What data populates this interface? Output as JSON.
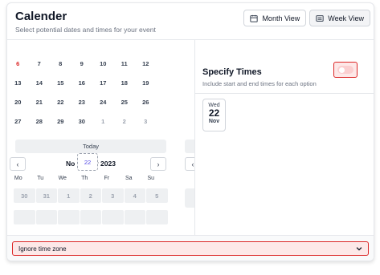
{
  "header": {
    "title": "Calender",
    "subtitle": "Select potential dates and times for your event",
    "month_view_label": "Month View",
    "week_view_label": "Week View"
  },
  "calendar": {
    "weeks": [
      [
        "6",
        "7",
        "8",
        "9",
        "10",
        "11",
        "12"
      ],
      [
        "13",
        "14",
        "15",
        "16",
        "17",
        "18",
        "19"
      ],
      [
        "20",
        "21",
        "22",
        "23",
        "24",
        "25",
        "26"
      ],
      [
        "27",
        "28",
        "29",
        "30",
        "1",
        "2",
        "3"
      ]
    ],
    "today_label": "Today",
    "month_label_left": "No",
    "month_label_right": "r 2023",
    "prev_icon": "‹",
    "next_icon": "›",
    "floating_date": "22",
    "weekdays": [
      "Mo",
      "Tu",
      "We",
      "Th",
      "Fr",
      "Sa",
      "Su"
    ],
    "next_week": [
      "30",
      "31",
      "1",
      "2",
      "3",
      "4",
      "5"
    ]
  },
  "specify_times": {
    "title": "Specify Times",
    "description": "Include start and end times for each option",
    "toggle_on": false
  },
  "selected_dates": [
    {
      "weekday": "Wed",
      "day": "22",
      "month": "Nov"
    }
  ],
  "timezone": {
    "label": "Ignore time zone"
  },
  "colors": {
    "accent_red": "#dc2626",
    "error_bg": "#fde8e8",
    "float_date": "#4f46e5"
  }
}
